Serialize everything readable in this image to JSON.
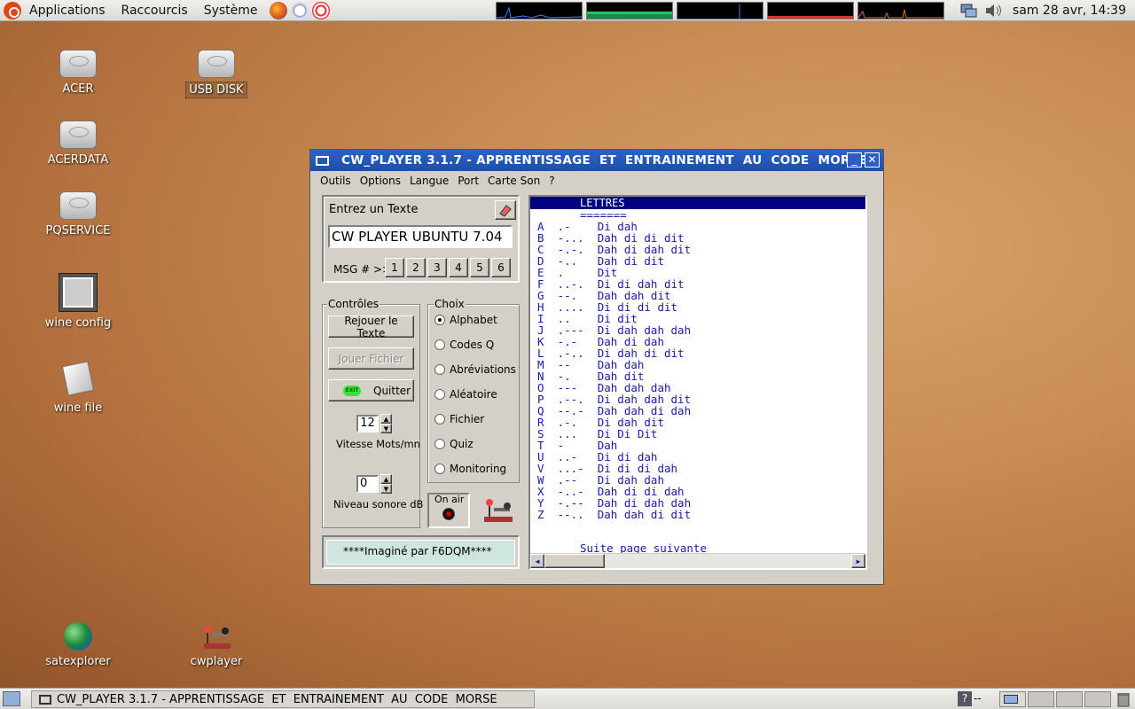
{
  "top_panel": {
    "menus": [
      "Applications",
      "Raccourcis",
      "Système"
    ],
    "clock": "sam 28 avr, 14:39"
  },
  "desktop_icons": [
    {
      "label": "ACER"
    },
    {
      "label": "USB DISK"
    },
    {
      "label": "ACERDATA"
    },
    {
      "label": "PQSERVICE"
    },
    {
      "label": "wine config"
    },
    {
      "label": "wine file"
    },
    {
      "label": "satexplorer"
    },
    {
      "label": "cwplayer"
    }
  ],
  "window": {
    "title": "CW_PLAYER 3.1.7 - APPRENTISSAGE  ET  ENTRAINEMENT  AU  CODE  MORSE",
    "menu": [
      "Outils",
      "Options",
      "Langue",
      "Port",
      "Carte Son",
      "?"
    ],
    "text_entry": {
      "label": "Entrez un Texte",
      "value": "CW PLAYER UBUNTU 7.04",
      "msg_label": "MSG # >>",
      "msg_buttons": [
        "1",
        "2",
        "3",
        "4",
        "5",
        "6"
      ]
    },
    "controls": {
      "title": "Contrôles",
      "replay": "Rejouer le Texte",
      "play_file": "Jouer Fichier",
      "quit": "Quitter",
      "exit_badge": "EXIT",
      "speed_value": "12",
      "speed_label": "Vitesse Mots/mn",
      "volume_value": "0",
      "volume_label": "Niveau sonore dB"
    },
    "choix": {
      "title": "Choix",
      "options": [
        "Alphabet",
        "Codes Q",
        "Abréviations",
        "Aléatoire",
        "Fichier",
        "Quiz",
        "Monitoring"
      ],
      "selected": "Alphabet"
    },
    "on_air": "On air",
    "credit": "****Imaginé par F6DQM****",
    "morse": {
      "header": "LETTRES",
      "underline": "=======",
      "lines": [
        "A  .-    Di dah",
        "B  -...  Dah di di dit",
        "C  -.-.  Dah di dah dit",
        "D  -..   Dah di dit",
        "E  .     Dit",
        "F  ..-.  Di di dah dit",
        "G  --.   Dah dah dit",
        "H  ....  Di di di dit",
        "I  ..    Di dit",
        "J  .---  Di dah dah dah",
        "K  -.-   Dah di dah",
        "L  .-..  Di dah di dit",
        "M  --    Dah dah",
        "N  -.    Dah dit",
        "O  ---   Dah dah dah",
        "P  .--.  Di dah dah dit",
        "Q  --.-  Dah dah di dah",
        "R  .-.   Di dah dit",
        "S  ...   Di Di Dit",
        "T  -     Dah",
        "U  ..-   Di di dah",
        "V  ...-  Di di di dah",
        "W  .--   Di dah dah",
        "X  -..-  Dah di di dah",
        "Y  -.--  Dah di dah dah",
        "Z  --..  Dah dah di dit"
      ],
      "footer": "Suite page suivante"
    }
  },
  "taskbar": {
    "task_label": "CW_PLAYER 3.1.7 - APPRENTISSAGE  ET  ENTRAINEMENT  AU  CODE  MORSE",
    "help": "?",
    "help_suffix": "--"
  }
}
